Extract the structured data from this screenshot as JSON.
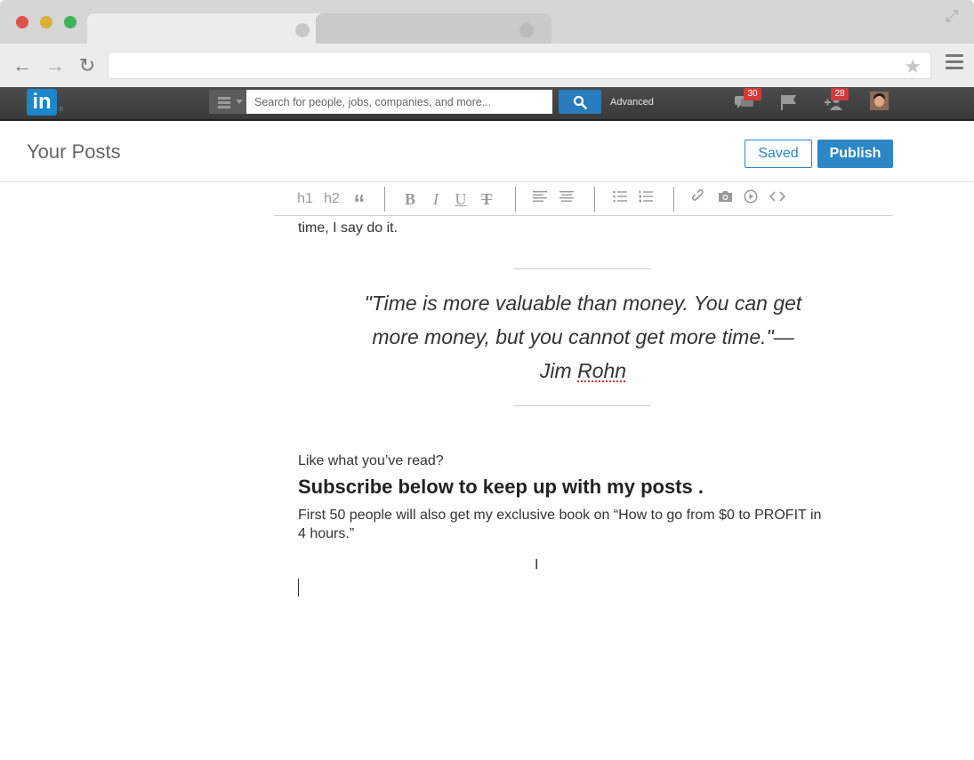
{
  "browser": {
    "tabs": [
      {
        "label": ""
      },
      {
        "label": ""
      }
    ],
    "address": ""
  },
  "linkedin": {
    "logo": "in",
    "search_placeholder": "Search for people, jobs, companies, and more...",
    "advanced_label": "Advanced",
    "messages_count": "30",
    "connections_count": "28"
  },
  "page": {
    "title": "Your Posts",
    "saved_label": "Saved",
    "publish_label": "Publish"
  },
  "editor_toolbar": {
    "h1": "h1",
    "h2": "h2",
    "quote": "“",
    "bold": "B",
    "italic": "I",
    "underline": "U",
    "strike": "T"
  },
  "content": {
    "text_fragment": "time, I say do it.",
    "quote_text": "\"Time is more valuable than money. You can get more money, but you cannot get more time.\"—Jim ",
    "quote_author_last": "Rohn",
    "lead": "Like what you’ve read?",
    "subscribe": "Subscribe below to keep up with my posts .",
    "description": "First 50 people will also get my exclusive book on “How to go from $0 to PROFIT in 4 hours.”"
  },
  "colors": {
    "brand": "#1b86c9",
    "accent": "#2d86c6",
    "badge": "#d23b3b"
  }
}
